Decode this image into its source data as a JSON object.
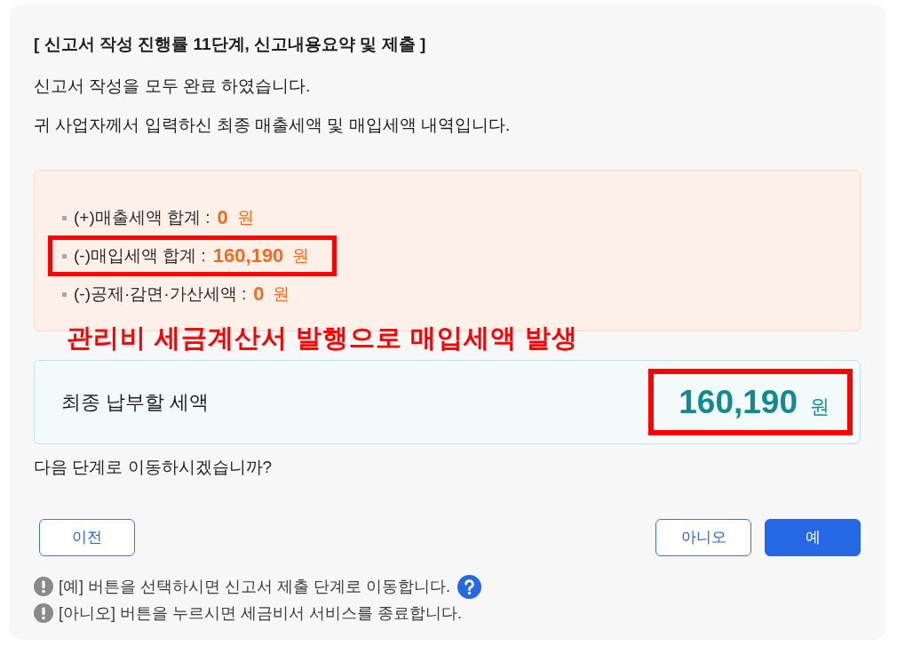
{
  "title": "[ 신고서 작성 진행률 11단계, 신고내용요약 및 제출 ]",
  "intro": [
    "신고서 작성을 모두 완료 하였습니다.",
    "귀 사업자께서 입력하신 최종 매출세액 및 매입세액 내역입니다."
  ],
  "summary": {
    "items": [
      {
        "label": "(+)매출세액 합계 :",
        "amount": "0",
        "unit": "원",
        "highlighted": false
      },
      {
        "label": "(-)매입세액 합계 :",
        "amount": "160,190",
        "unit": "원",
        "highlighted": true
      },
      {
        "label": "(-)공제·감면·가산세액 :",
        "amount": "0",
        "unit": "원",
        "highlighted": false
      }
    ]
  },
  "annotation": "관리비 세금계산서 발행으로 매입세액 발생",
  "total": {
    "label": "최종 납부할 세액",
    "amount": "160,190",
    "unit": "원",
    "highlighted": true
  },
  "question": "다음 단계로 이동하시겠습니까?",
  "buttons": [
    {
      "label": "이전",
      "kind": "outline"
    },
    {
      "label": "아니오",
      "kind": "outline"
    },
    {
      "label": "예",
      "kind": "primary"
    }
  ],
  "notes": [
    {
      "text": "[예] 버튼을 선택하시면 신고서 제출 단계로 이동합니다.",
      "help": true
    },
    {
      "text": "[아니오] 버튼을 누르시면 세금비서 서비스를 종료합니다.",
      "help": false
    }
  ]
}
